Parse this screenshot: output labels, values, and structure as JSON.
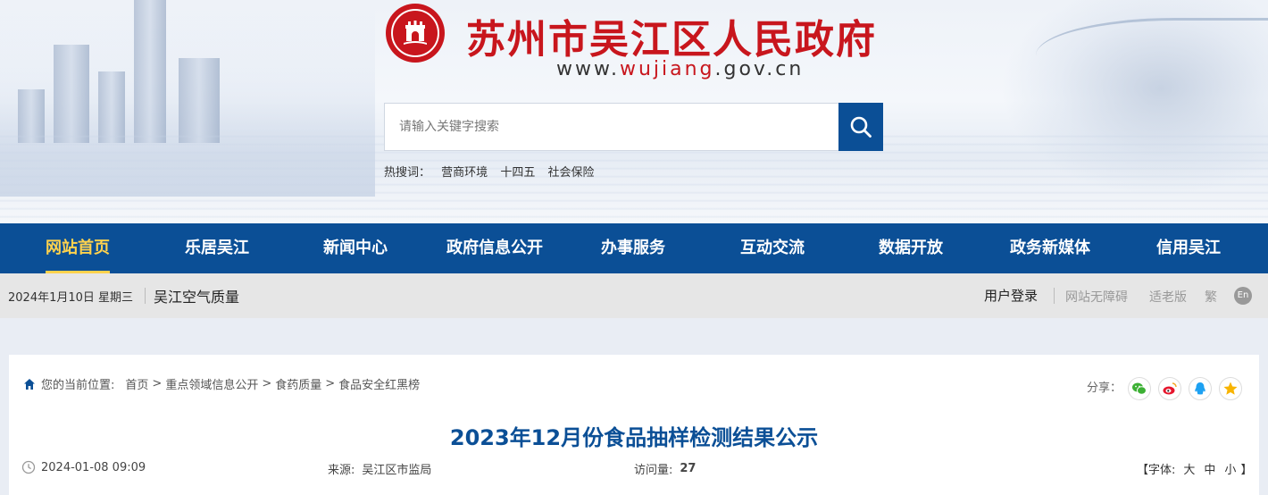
{
  "header": {
    "site_title": "苏州市吴江区人民政府",
    "url_prefix": "www.",
    "url_highlight": "wujiang",
    "url_suffix": ".gov.cn",
    "search_placeholder": "请输入关键字搜索",
    "hot_label": "热搜词：",
    "hot_words": [
      "营商环境",
      "十四五",
      "社会保险"
    ]
  },
  "nav": {
    "items": [
      {
        "label": "网站首页",
        "active": true
      },
      {
        "label": "乐居吴江",
        "active": false
      },
      {
        "label": "新闻中心",
        "active": false
      },
      {
        "label": "政府信息公开",
        "active": false
      },
      {
        "label": "办事服务",
        "active": false
      },
      {
        "label": "互动交流",
        "active": false
      },
      {
        "label": "数据开放",
        "active": false
      },
      {
        "label": "政务新媒体",
        "active": false
      },
      {
        "label": "信用吴江",
        "active": false
      }
    ]
  },
  "infobar": {
    "date": "2024年1月10日 星期三",
    "air_quality": "吴江空气质量",
    "login": "用户登录",
    "accessibility": "网站无障碍",
    "elder_mode": "适老版",
    "traditional": "繁",
    "english": "En"
  },
  "breadcrumb": {
    "label": "您的当前位置:",
    "items": [
      "首页",
      "重点领域信息公开",
      "食药质量",
      "食品安全红黑榜"
    ],
    "separator": ">"
  },
  "share": {
    "label": "分享：",
    "icons": [
      "wechat-icon",
      "weibo-icon",
      "qq-icon",
      "qzone-icon"
    ]
  },
  "article": {
    "title": "2023年12月份食品抽样检测结果公示",
    "datetime": "2024-01-08 09:09",
    "source_label": "来源:",
    "source": "吴江区市监局",
    "views_label": "访问量:",
    "views": "27",
    "font_label": "【字体:",
    "font_large": "大",
    "font_medium": "中",
    "font_small": "小",
    "font_close": "】"
  },
  "colors": {
    "brand_red": "#c8161d",
    "nav_blue": "#0b4f96",
    "active_yellow": "#ffd24d"
  }
}
